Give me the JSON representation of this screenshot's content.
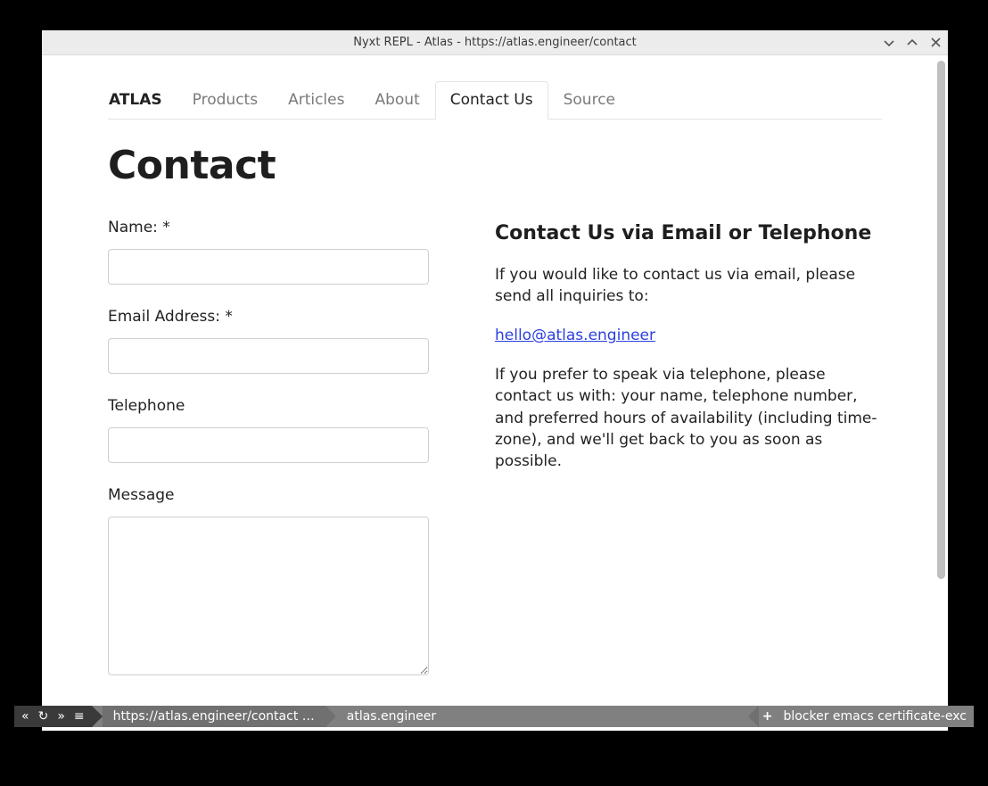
{
  "window": {
    "title": "Nyxt REPL - Atlas - https://atlas.engineer/contact"
  },
  "nav": {
    "brand": "ATLAS",
    "items": [
      {
        "label": "Products",
        "active": false
      },
      {
        "label": "Articles",
        "active": false
      },
      {
        "label": "About",
        "active": false
      },
      {
        "label": "Contact Us",
        "active": true
      },
      {
        "label": "Source",
        "active": false
      }
    ]
  },
  "page": {
    "title": "Contact"
  },
  "form": {
    "name": {
      "label": "Name: *",
      "value": ""
    },
    "email": {
      "label": "Email Address: *",
      "value": ""
    },
    "telephone": {
      "label": "Telephone",
      "value": ""
    },
    "message": {
      "label": "Message",
      "value": ""
    }
  },
  "info": {
    "heading": "Contact Us via Email or Telephone",
    "p1": "If you would like to contact us via email, please send all inquiries to:",
    "email_link": "hello@atlas.engineer",
    "p2": "If you prefer to speak via telephone, please contact us with: your name, telephone number, and preferred hours of availability (including time-zone), and we'll get back to you as soon as possible."
  },
  "modeline": {
    "controls": {
      "back": "«",
      "reload": "↻",
      "forward": "»",
      "menu": "≡"
    },
    "url": "https://atlas.engineer/contact …",
    "domain": "atlas.engineer",
    "plus": "+",
    "modes": "blocker  emacs  certificate-exc"
  }
}
